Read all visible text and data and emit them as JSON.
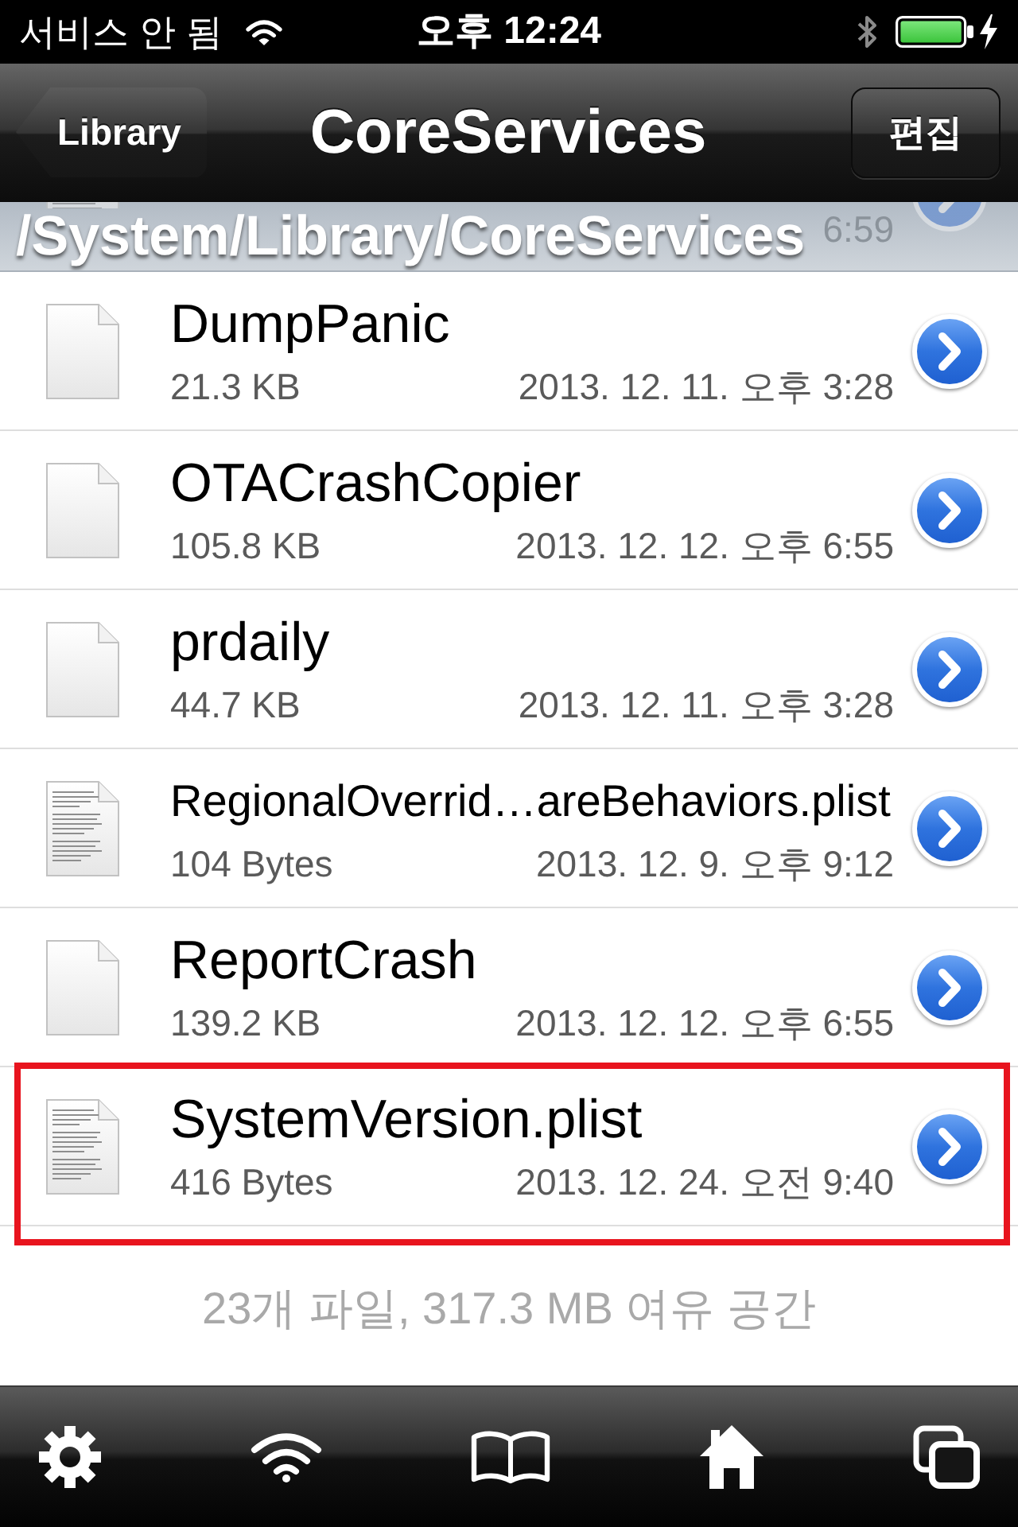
{
  "status_bar": {
    "carrier": "서비스 안 됨",
    "time": "오후 12:24"
  },
  "nav_bar": {
    "back_button": "Library",
    "title": "CoreServices",
    "edit_button": "편집"
  },
  "path_bar": {
    "path": "/System/Library/CoreServices",
    "row_behind": {
      "kind": "text",
      "date": "6:59"
    }
  },
  "files": [
    {
      "kind": "blank",
      "name": "DumpPanic",
      "size": "21.3 KB",
      "date": "2013. 12. 11. 오후 3:28",
      "highlighted": false
    },
    {
      "kind": "blank",
      "name": "OTACrashCopier",
      "size": "105.8 KB",
      "date": "2013. 12. 12. 오후 6:55",
      "highlighted": false
    },
    {
      "kind": "blank",
      "name": "prdaily",
      "size": "44.7 KB",
      "date": "2013. 12. 11. 오후 3:28",
      "highlighted": false
    },
    {
      "kind": "text",
      "name": "RegionalOverrid…areBehaviors.plist",
      "size": "104 Bytes",
      "date": "2013. 12. 9. 오후 9:12",
      "highlighted": false
    },
    {
      "kind": "blank",
      "name": "ReportCrash",
      "size": "139.2 KB",
      "date": "2013. 12. 12. 오후 6:55",
      "highlighted": false
    },
    {
      "kind": "text",
      "name": "SystemVersion.plist",
      "size": "416 Bytes",
      "date": "2013. 12. 24. 오전 9:40",
      "highlighted": true
    }
  ],
  "footer": "23개 파일, 317.3 MB 여유 공간"
}
